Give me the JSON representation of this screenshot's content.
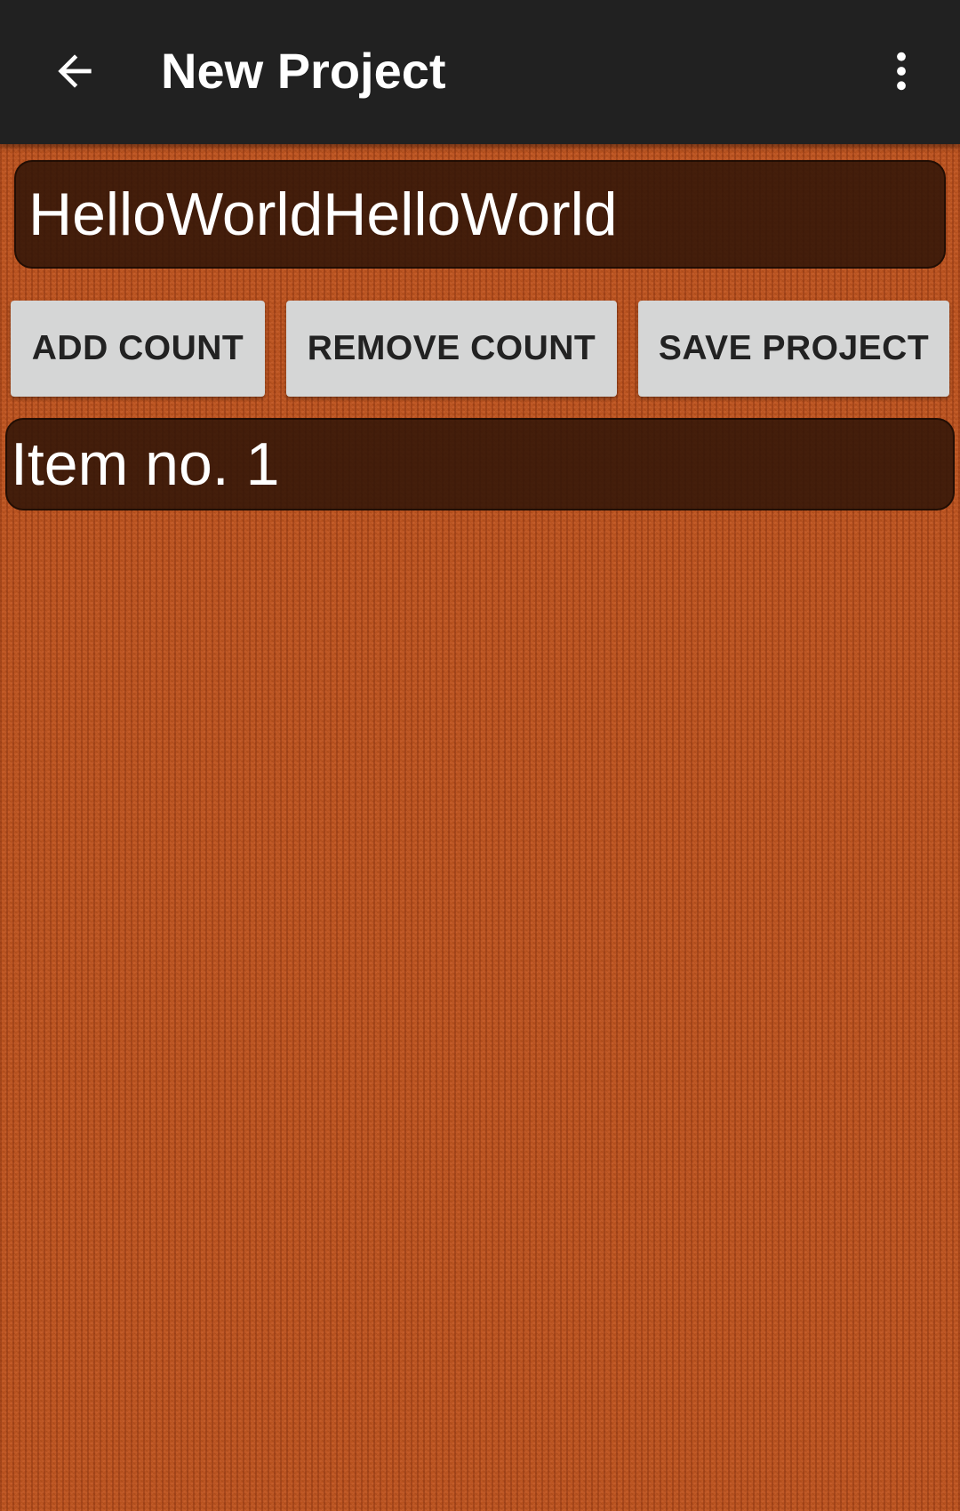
{
  "app_bar": {
    "title": "New Project",
    "back_icon": "arrow-back-icon",
    "menu_icon": "more-vertical-icon",
    "background_color": "#212121"
  },
  "project_name": {
    "value": "HelloWorldHelloWorld"
  },
  "actions": {
    "add_count_label": "ADD COUNT",
    "remove_count_label": "REMOVE COUNT",
    "save_project_label": "SAVE PROJECT"
  },
  "items": [
    {
      "label": "Item no. 1"
    }
  ],
  "colors": {
    "background_texture": "#b8521f",
    "field_background": "#321608",
    "button_background": "#d5d6d6",
    "button_text": "#222222"
  }
}
